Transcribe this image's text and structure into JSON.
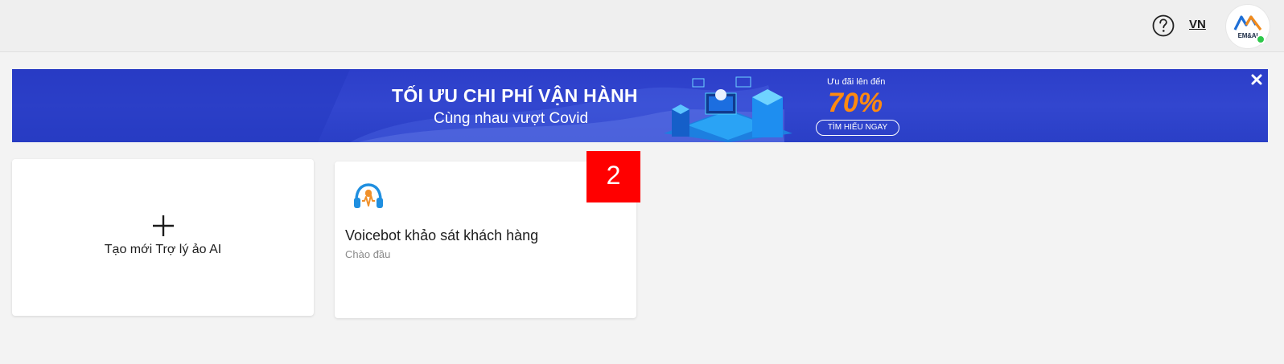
{
  "header": {
    "help_icon": "question-circle-icon",
    "language": "VN",
    "avatar_text": "EM&AI",
    "status_color": "#2ec84a"
  },
  "banner": {
    "title": "TỐI ƯU CHI PHÍ VẬN HÀNH",
    "subtitle": "Cùng nhau vượt Covid",
    "promo_small": "Ưu đãi lên đến",
    "promo_big": "70%",
    "cta": "TÌM HIỂU NGAY",
    "close_icon": "close-icon",
    "bg_color": "#2f43cc",
    "accent_color": "#ff8a10"
  },
  "cards": {
    "new_assistant": {
      "label": "Tạo mới Trợ lý ảo AI",
      "icon": "plus-icon"
    },
    "voicebot": {
      "name": "Voicebot khảo sát khách hàng",
      "subtitle": "Chào đầu",
      "icon": "headset-icon"
    }
  },
  "annotation": {
    "step": "2",
    "color": "#ff0000"
  }
}
